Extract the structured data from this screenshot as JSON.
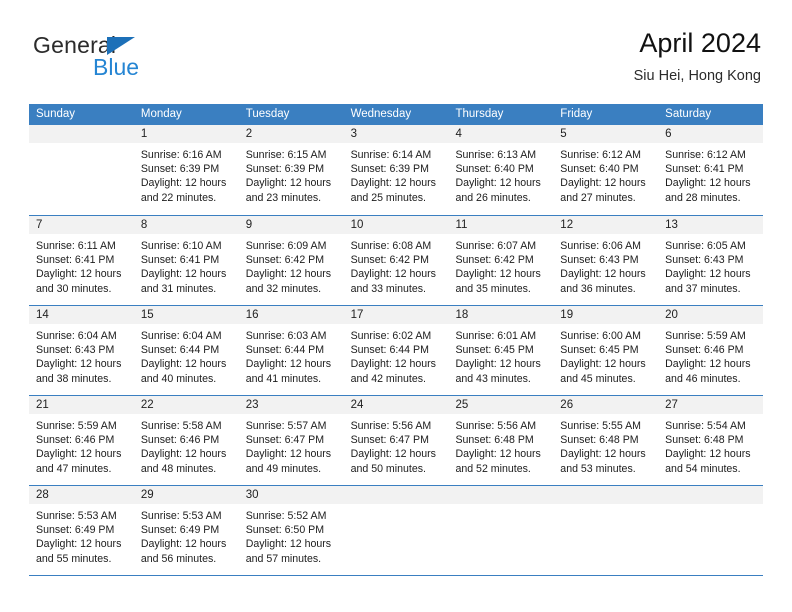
{
  "brand": {
    "name_top": "General",
    "name_bottom": "Blue",
    "accent_color": "#1c70b8",
    "blue_text_color": "#2585d3"
  },
  "header": {
    "title": "April 2024",
    "subtitle": "Siu Hei, Hong Kong"
  },
  "calendar": {
    "header_bg": "#3a7fc1",
    "daynum_bg": "#f2f2f2",
    "weekdays": [
      "Sunday",
      "Monday",
      "Tuesday",
      "Wednesday",
      "Thursday",
      "Friday",
      "Saturday"
    ],
    "weeks": [
      [
        {
          "day": "",
          "lines": []
        },
        {
          "day": "1",
          "lines": [
            "Sunrise: 6:16 AM",
            "Sunset: 6:39 PM",
            "Daylight: 12 hours",
            "and 22 minutes."
          ]
        },
        {
          "day": "2",
          "lines": [
            "Sunrise: 6:15 AM",
            "Sunset: 6:39 PM",
            "Daylight: 12 hours",
            "and 23 minutes."
          ]
        },
        {
          "day": "3",
          "lines": [
            "Sunrise: 6:14 AM",
            "Sunset: 6:39 PM",
            "Daylight: 12 hours",
            "and 25 minutes."
          ]
        },
        {
          "day": "4",
          "lines": [
            "Sunrise: 6:13 AM",
            "Sunset: 6:40 PM",
            "Daylight: 12 hours",
            "and 26 minutes."
          ]
        },
        {
          "day": "5",
          "lines": [
            "Sunrise: 6:12 AM",
            "Sunset: 6:40 PM",
            "Daylight: 12 hours",
            "and 27 minutes."
          ]
        },
        {
          "day": "6",
          "lines": [
            "Sunrise: 6:12 AM",
            "Sunset: 6:41 PM",
            "Daylight: 12 hours",
            "and 28 minutes."
          ]
        }
      ],
      [
        {
          "day": "7",
          "lines": [
            "Sunrise: 6:11 AM",
            "Sunset: 6:41 PM",
            "Daylight: 12 hours",
            "and 30 minutes."
          ]
        },
        {
          "day": "8",
          "lines": [
            "Sunrise: 6:10 AM",
            "Sunset: 6:41 PM",
            "Daylight: 12 hours",
            "and 31 minutes."
          ]
        },
        {
          "day": "9",
          "lines": [
            "Sunrise: 6:09 AM",
            "Sunset: 6:42 PM",
            "Daylight: 12 hours",
            "and 32 minutes."
          ]
        },
        {
          "day": "10",
          "lines": [
            "Sunrise: 6:08 AM",
            "Sunset: 6:42 PM",
            "Daylight: 12 hours",
            "and 33 minutes."
          ]
        },
        {
          "day": "11",
          "lines": [
            "Sunrise: 6:07 AM",
            "Sunset: 6:42 PM",
            "Daylight: 12 hours",
            "and 35 minutes."
          ]
        },
        {
          "day": "12",
          "lines": [
            "Sunrise: 6:06 AM",
            "Sunset: 6:43 PM",
            "Daylight: 12 hours",
            "and 36 minutes."
          ]
        },
        {
          "day": "13",
          "lines": [
            "Sunrise: 6:05 AM",
            "Sunset: 6:43 PM",
            "Daylight: 12 hours",
            "and 37 minutes."
          ]
        }
      ],
      [
        {
          "day": "14",
          "lines": [
            "Sunrise: 6:04 AM",
            "Sunset: 6:43 PM",
            "Daylight: 12 hours",
            "and 38 minutes."
          ]
        },
        {
          "day": "15",
          "lines": [
            "Sunrise: 6:04 AM",
            "Sunset: 6:44 PM",
            "Daylight: 12 hours",
            "and 40 minutes."
          ]
        },
        {
          "day": "16",
          "lines": [
            "Sunrise: 6:03 AM",
            "Sunset: 6:44 PM",
            "Daylight: 12 hours",
            "and 41 minutes."
          ]
        },
        {
          "day": "17",
          "lines": [
            "Sunrise: 6:02 AM",
            "Sunset: 6:44 PM",
            "Daylight: 12 hours",
            "and 42 minutes."
          ]
        },
        {
          "day": "18",
          "lines": [
            "Sunrise: 6:01 AM",
            "Sunset: 6:45 PM",
            "Daylight: 12 hours",
            "and 43 minutes."
          ]
        },
        {
          "day": "19",
          "lines": [
            "Sunrise: 6:00 AM",
            "Sunset: 6:45 PM",
            "Daylight: 12 hours",
            "and 45 minutes."
          ]
        },
        {
          "day": "20",
          "lines": [
            "Sunrise: 5:59 AM",
            "Sunset: 6:46 PM",
            "Daylight: 12 hours",
            "and 46 minutes."
          ]
        }
      ],
      [
        {
          "day": "21",
          "lines": [
            "Sunrise: 5:59 AM",
            "Sunset: 6:46 PM",
            "Daylight: 12 hours",
            "and 47 minutes."
          ]
        },
        {
          "day": "22",
          "lines": [
            "Sunrise: 5:58 AM",
            "Sunset: 6:46 PM",
            "Daylight: 12 hours",
            "and 48 minutes."
          ]
        },
        {
          "day": "23",
          "lines": [
            "Sunrise: 5:57 AM",
            "Sunset: 6:47 PM",
            "Daylight: 12 hours",
            "and 49 minutes."
          ]
        },
        {
          "day": "24",
          "lines": [
            "Sunrise: 5:56 AM",
            "Sunset: 6:47 PM",
            "Daylight: 12 hours",
            "and 50 minutes."
          ]
        },
        {
          "day": "25",
          "lines": [
            "Sunrise: 5:56 AM",
            "Sunset: 6:48 PM",
            "Daylight: 12 hours",
            "and 52 minutes."
          ]
        },
        {
          "day": "26",
          "lines": [
            "Sunrise: 5:55 AM",
            "Sunset: 6:48 PM",
            "Daylight: 12 hours",
            "and 53 minutes."
          ]
        },
        {
          "day": "27",
          "lines": [
            "Sunrise: 5:54 AM",
            "Sunset: 6:48 PM",
            "Daylight: 12 hours",
            "and 54 minutes."
          ]
        }
      ],
      [
        {
          "day": "28",
          "lines": [
            "Sunrise: 5:53 AM",
            "Sunset: 6:49 PM",
            "Daylight: 12 hours",
            "and 55 minutes."
          ]
        },
        {
          "day": "29",
          "lines": [
            "Sunrise: 5:53 AM",
            "Sunset: 6:49 PM",
            "Daylight: 12 hours",
            "and 56 minutes."
          ]
        },
        {
          "day": "30",
          "lines": [
            "Sunrise: 5:52 AM",
            "Sunset: 6:50 PM",
            "Daylight: 12 hours",
            "and 57 minutes."
          ]
        },
        {
          "day": "",
          "lines": []
        },
        {
          "day": "",
          "lines": []
        },
        {
          "day": "",
          "lines": []
        },
        {
          "day": "",
          "lines": []
        }
      ]
    ]
  }
}
